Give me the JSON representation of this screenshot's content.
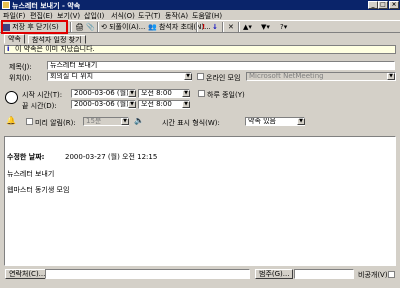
{
  "window": {
    "title": "뉴스레터 보내기 - 약속"
  },
  "menu": [
    "파일(F)",
    "편집(E)",
    "보기(V)",
    "삽입(I)",
    "서식(O)",
    "도구(T)",
    "동작(A)",
    "도움말(H)"
  ],
  "toolbar": {
    "save_close": "저장 후 닫기(S)",
    "recurrence": "되풀이(A)...",
    "invite": "참석자 초대(N)..."
  },
  "tabs": [
    "약속",
    "참석자 일정 찾기"
  ],
  "info": "이 약속은 이미 지났습니다.",
  "form": {
    "subject_label": "제목(J):",
    "subject_value": "뉴스레터 보내기",
    "location_label": "위치(I):",
    "location_value": "회의실 디 위치",
    "online_label": "온라인 모임",
    "online_value": "Microsoft NetMeeting",
    "start_label": "시작 시간(T):",
    "start_date": "2000-03-06 (월)",
    "start_time": "오전 8:00",
    "allday_label": "하루 종일(Y)",
    "end_label": "끝 시간(D):",
    "end_date": "2000-03-06 (월)",
    "end_time": "오전 8:00",
    "reminder_label": "미리 알림(R):",
    "reminder_value": "15분",
    "showtime_label": "시간 표시 형식(W):",
    "showtime_value": "약속 있음"
  },
  "body": {
    "modified_label": "수정한 날짜:",
    "modified_value": "2000-03-27 (월) 오전 12:15",
    "line1": "뉴스레터 보내기",
    "line2": "웹마스터 동기생 모임"
  },
  "bottom": {
    "contacts": "연락처(C)...",
    "categories": "범주(G)...",
    "private": "비공개(V)"
  }
}
